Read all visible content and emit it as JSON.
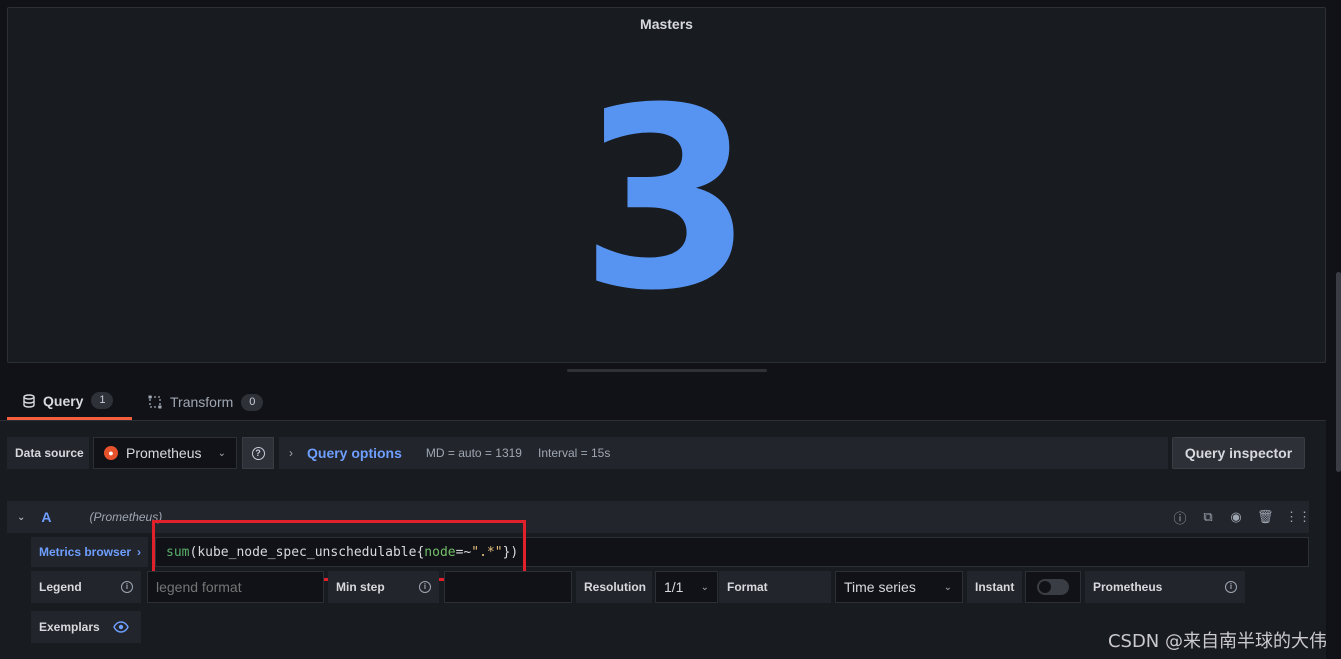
{
  "panel": {
    "title": "Masters",
    "value": "3",
    "value_color": "#5794f2"
  },
  "tabs": [
    {
      "label": "Query",
      "count": "1"
    },
    {
      "label": "Transform",
      "count": "0"
    }
  ],
  "datasource": {
    "label": "Data source",
    "name": "Prometheus",
    "help_icon": "question-circle-icon"
  },
  "query_options": {
    "label": "Query options",
    "md": "MD = auto = 1319",
    "interval": "Interval = 15s"
  },
  "query_inspector": {
    "label": "Query inspector"
  },
  "query_row": {
    "ref_id": "A",
    "datasource_hint": "(Prometheus)",
    "metrics_browser": "Metrics browser",
    "expr": {
      "fn": "sum",
      "open_paren": "(",
      "metric": "kube_node_spec_unschedulable",
      "open_brace": "{",
      "label": "node",
      "op": "=~",
      "value": "\".*\"",
      "close": "})"
    }
  },
  "options": {
    "legend_label": "Legend",
    "legend_placeholder": "legend format",
    "min_step_label": "Min step",
    "min_step_value": "",
    "resolution_label": "Resolution",
    "resolution_value": "1/1",
    "format_label": "Format",
    "format_value": "Time series",
    "instant_label": "Instant",
    "instant_on": false,
    "prometheus_label": "Prometheus",
    "exemplars_label": "Exemplars"
  },
  "watermark": "CSDN @来自南半球的大伟",
  "colors": {
    "accent": "#6e9fff",
    "tab_active": "#f55f3e",
    "highlight": "#e0202a"
  }
}
